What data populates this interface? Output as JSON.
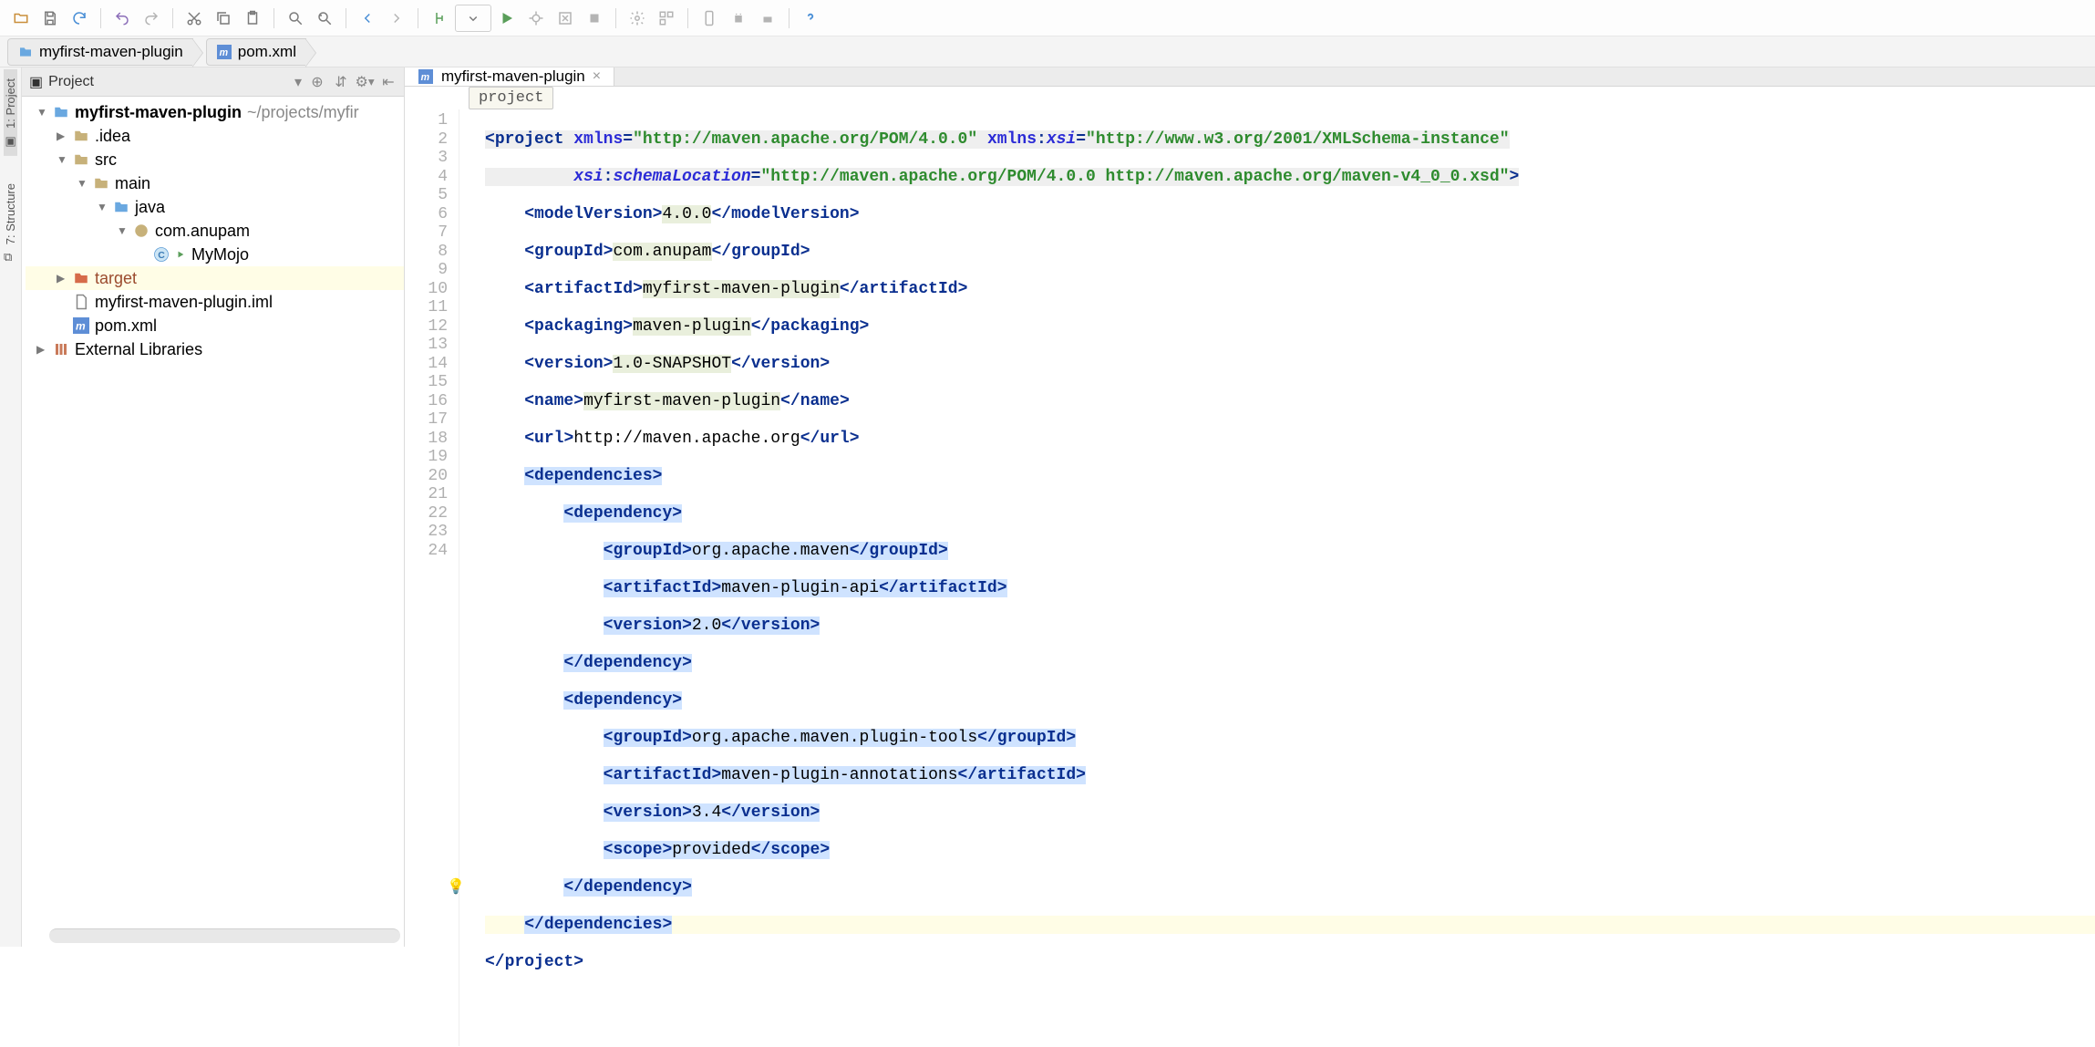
{
  "breadcrumb": {
    "root_label": "myfirst-maven-plugin",
    "file_label": "pom.xml"
  },
  "project_panel": {
    "title": "Project",
    "root": {
      "name": "myfirst-maven-plugin",
      "path": "~/projects/myfir"
    },
    "tree": {
      "idea": ".idea",
      "src": "src",
      "main": "main",
      "java": "java",
      "pkg": "com.anupam",
      "cls": "MyMojo",
      "target": "target",
      "iml": "myfirst-maven-plugin.iml",
      "pom": "pom.xml",
      "ext": "External Libraries"
    }
  },
  "editor": {
    "tab_label": "myfirst-maven-plugin",
    "crumb": "project",
    "gutter": [
      "1",
      "2",
      "3",
      "4",
      "5",
      "6",
      "7",
      "8",
      "9",
      "10",
      "11",
      "12",
      "13",
      "14",
      "15",
      "16",
      "17",
      "18",
      "19",
      "20",
      "21",
      "22",
      "23",
      "24"
    ],
    "xml": {
      "l1": {
        "tag_open": "project",
        "attr1": "xmlns",
        "val1": "http://maven.apache.org/POM/4.0.0",
        "attr2_ns": "xmlns",
        "attr2": "xsi",
        "val2": "http://www.w3.org/2001/XMLSchema-instance"
      },
      "l2": {
        "attr_ns": "xsi",
        "attr": "schemaLocation",
        "val": "http://maven.apache.org/POM/4.0.0 http://maven.apache.org/maven-v4_0_0.xsd"
      },
      "l3": {
        "tag": "modelVersion",
        "text": "4.0.0"
      },
      "l4": {
        "tag": "groupId",
        "text": "com.anupam"
      },
      "l5": {
        "tag": "artifactId",
        "text": "myfirst-maven-plugin"
      },
      "l6": {
        "tag": "packaging",
        "text": "maven-plugin"
      },
      "l7": {
        "tag": "version",
        "text": "1.0-SNAPSHOT"
      },
      "l8": {
        "tag": "name",
        "text": "myfirst-maven-plugin"
      },
      "l9": {
        "tag": "url",
        "text": "http://maven.apache.org"
      },
      "l10": {
        "tag": "dependencies"
      },
      "l11": {
        "tag": "dependency"
      },
      "l12": {
        "tag": "groupId",
        "text": "org.apache.maven"
      },
      "l13": {
        "tag": "artifactId",
        "text": "maven-plugin-api"
      },
      "l14": {
        "tag": "version",
        "text": "2.0"
      },
      "l15": {
        "tag_close": "dependency"
      },
      "l16": {
        "tag": "dependency"
      },
      "l17": {
        "tag": "groupId",
        "text": "org.apache.maven.plugin-tools"
      },
      "l18": {
        "tag": "artifactId",
        "text": "maven-plugin-annotations"
      },
      "l19": {
        "tag": "version",
        "text": "3.4"
      },
      "l20": {
        "tag": "scope",
        "text": "provided"
      },
      "l21": {
        "tag_close": "dependency"
      },
      "l22": {
        "tag_close": "dependencies"
      },
      "l23": {
        "tag_close": "project"
      }
    }
  },
  "vtabs": {
    "project": "1: Project",
    "structure": "7: Structure"
  }
}
